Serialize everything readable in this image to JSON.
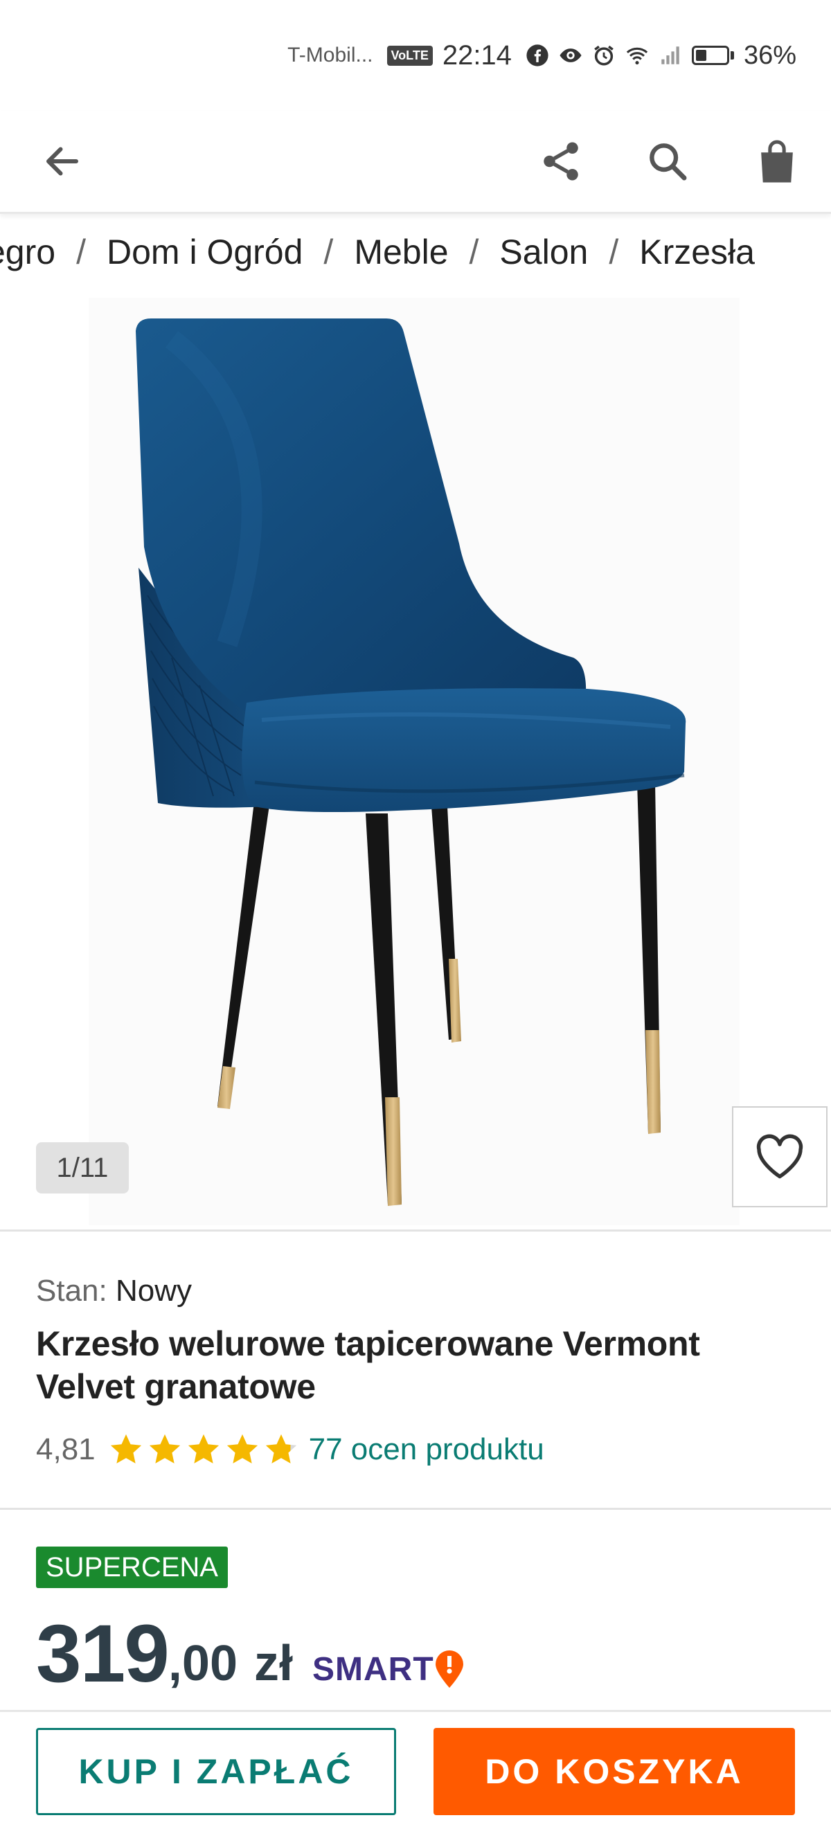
{
  "status_bar": {
    "carrier": "T-Mobil...",
    "volte": "VoLTE",
    "time": "22:14",
    "battery": "36%",
    "battery_level": 0.36,
    "icons": [
      "facebook-icon",
      "eye-icon",
      "alarm-icon",
      "wifi-icon",
      "signal-icon",
      "battery-icon"
    ]
  },
  "app_bar": {
    "icons": [
      "back-arrow-icon",
      "share-icon",
      "search-icon",
      "shopping-bag-icon"
    ]
  },
  "breadcrumb": [
    "egro",
    "Dom i Ogród",
    "Meble",
    "Salon",
    "Krzesła"
  ],
  "gallery": {
    "counter": "1/11",
    "current": 1,
    "total": 11
  },
  "product": {
    "condition_label": "Stan:",
    "condition_value": "Nowy",
    "title": "Krzesło welurowe tapicerowane Vermont Velvet granatowe",
    "rating_value": "4,81",
    "rating_stars": 4.81,
    "rating_max": 5,
    "reviews": "77 ocen produktu",
    "badge": "SUPERCENA",
    "price_int": "319",
    "price_dec": ",00",
    "currency": "zł",
    "smart_label": "SMART"
  },
  "actions": {
    "buy_label": "KUP I ZAPŁAĆ",
    "cart_label": "DO KOSZYKA"
  },
  "colors": {
    "teal": "#0a7c73",
    "orange": "#ff5a00",
    "badge_green": "#1a8a2e",
    "star": "#f5b800",
    "smart_purple": "#3e2f82",
    "chair_blue": "#15497a"
  }
}
